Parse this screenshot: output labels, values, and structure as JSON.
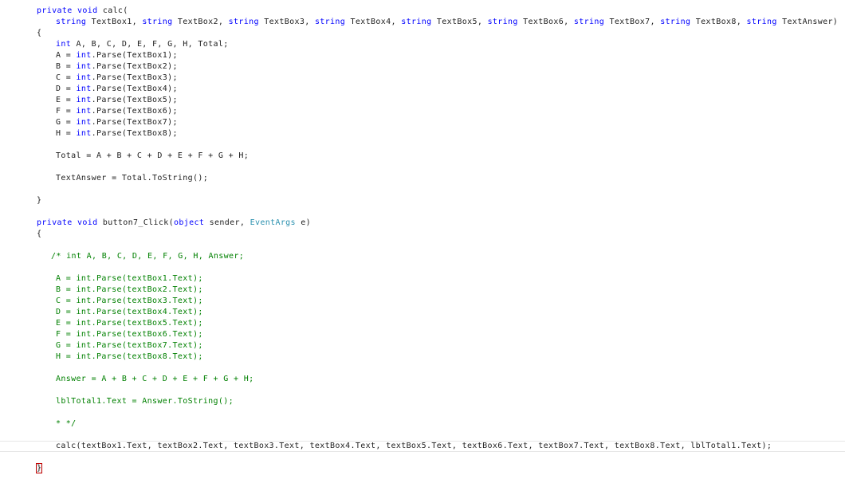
{
  "colors": {
    "keyword": "#0000ff",
    "type": "#2b91af",
    "comment": "#008000",
    "text": "#1e1e1e",
    "brace_highlight": "#c00000",
    "current_line_border": "#e6e6e6"
  },
  "code_lines": [
    {
      "indent": 46,
      "tokens": [
        {
          "t": "kw",
          "v": "private"
        },
        {
          "t": "plain",
          "v": " "
        },
        {
          "t": "kw",
          "v": "void"
        },
        {
          "t": "plain",
          "v": " calc("
        }
      ]
    },
    {
      "indent": 70,
      "tokens": [
        {
          "t": "kw",
          "v": "string"
        },
        {
          "t": "plain",
          "v": " TextBox1, "
        },
        {
          "t": "kw",
          "v": "string"
        },
        {
          "t": "plain",
          "v": " TextBox2, "
        },
        {
          "t": "kw",
          "v": "string"
        },
        {
          "t": "plain",
          "v": " TextBox3, "
        },
        {
          "t": "kw",
          "v": "string"
        },
        {
          "t": "plain",
          "v": " TextBox4, "
        },
        {
          "t": "kw",
          "v": "string"
        },
        {
          "t": "plain",
          "v": " TextBox5, "
        },
        {
          "t": "kw",
          "v": "string"
        },
        {
          "t": "plain",
          "v": " TextBox6, "
        },
        {
          "t": "kw",
          "v": "string"
        },
        {
          "t": "plain",
          "v": " TextBox7, "
        },
        {
          "t": "kw",
          "v": "string"
        },
        {
          "t": "plain",
          "v": " TextBox8, "
        },
        {
          "t": "kw",
          "v": "string"
        },
        {
          "t": "plain",
          "v": " TextAnswer)"
        }
      ]
    },
    {
      "indent": 46,
      "tokens": [
        {
          "t": "plain",
          "v": "{"
        }
      ]
    },
    {
      "indent": 70,
      "tokens": [
        {
          "t": "kw",
          "v": "int"
        },
        {
          "t": "plain",
          "v": " A, B, C, D, E, F, G, H, Total;"
        }
      ]
    },
    {
      "indent": 70,
      "tokens": [
        {
          "t": "plain",
          "v": "A = "
        },
        {
          "t": "kw",
          "v": "int"
        },
        {
          "t": "plain",
          "v": ".Parse(TextBox1);"
        }
      ]
    },
    {
      "indent": 70,
      "tokens": [
        {
          "t": "plain",
          "v": "B = "
        },
        {
          "t": "kw",
          "v": "int"
        },
        {
          "t": "plain",
          "v": ".Parse(TextBox2);"
        }
      ]
    },
    {
      "indent": 70,
      "tokens": [
        {
          "t": "plain",
          "v": "C = "
        },
        {
          "t": "kw",
          "v": "int"
        },
        {
          "t": "plain",
          "v": ".Parse(TextBox3);"
        }
      ]
    },
    {
      "indent": 70,
      "tokens": [
        {
          "t": "plain",
          "v": "D = "
        },
        {
          "t": "kw",
          "v": "int"
        },
        {
          "t": "plain",
          "v": ".Parse(TextBox4);"
        }
      ]
    },
    {
      "indent": 70,
      "tokens": [
        {
          "t": "plain",
          "v": "E = "
        },
        {
          "t": "kw",
          "v": "int"
        },
        {
          "t": "plain",
          "v": ".Parse(TextBox5);"
        }
      ]
    },
    {
      "indent": 70,
      "tokens": [
        {
          "t": "plain",
          "v": "F = "
        },
        {
          "t": "kw",
          "v": "int"
        },
        {
          "t": "plain",
          "v": ".Parse(TextBox6);"
        }
      ]
    },
    {
      "indent": 70,
      "tokens": [
        {
          "t": "plain",
          "v": "G = "
        },
        {
          "t": "kw",
          "v": "int"
        },
        {
          "t": "plain",
          "v": ".Parse(TextBox7);"
        }
      ]
    },
    {
      "indent": 70,
      "tokens": [
        {
          "t": "plain",
          "v": "H = "
        },
        {
          "t": "kw",
          "v": "int"
        },
        {
          "t": "plain",
          "v": ".Parse(TextBox8);"
        }
      ]
    },
    {
      "indent": 70,
      "tokens": []
    },
    {
      "indent": 70,
      "tokens": [
        {
          "t": "plain",
          "v": "Total = A + B + C + D + E + F + G + H;"
        }
      ]
    },
    {
      "indent": 70,
      "tokens": []
    },
    {
      "indent": 70,
      "tokens": [
        {
          "t": "plain",
          "v": "TextAnswer = Total.ToString();"
        }
      ]
    },
    {
      "indent": 70,
      "tokens": []
    },
    {
      "indent": 46,
      "tokens": [
        {
          "t": "plain",
          "v": "}"
        }
      ]
    },
    {
      "indent": 46,
      "tokens": []
    },
    {
      "indent": 46,
      "tokens": [
        {
          "t": "kw",
          "v": "private"
        },
        {
          "t": "plain",
          "v": " "
        },
        {
          "t": "kw",
          "v": "void"
        },
        {
          "t": "plain",
          "v": " button7_Click("
        },
        {
          "t": "kw",
          "v": "object"
        },
        {
          "t": "plain",
          "v": " sender, "
        },
        {
          "t": "type",
          "v": "EventArgs"
        },
        {
          "t": "plain",
          "v": " e)"
        }
      ]
    },
    {
      "indent": 46,
      "tokens": [
        {
          "t": "plain",
          "v": "{"
        }
      ]
    },
    {
      "indent": 46,
      "tokens": []
    },
    {
      "indent": 64,
      "tokens": [
        {
          "t": "comment",
          "v": "/* int A, B, C, D, E, F, G, H, Answer;"
        }
      ]
    },
    {
      "indent": 64,
      "tokens": []
    },
    {
      "indent": 70,
      "tokens": [
        {
          "t": "comment",
          "v": "A = int.Parse(textBox1.Text);"
        }
      ]
    },
    {
      "indent": 70,
      "tokens": [
        {
          "t": "comment",
          "v": "B = int.Parse(textBox2.Text);"
        }
      ]
    },
    {
      "indent": 70,
      "tokens": [
        {
          "t": "comment",
          "v": "C = int.Parse(textBox3.Text);"
        }
      ]
    },
    {
      "indent": 70,
      "tokens": [
        {
          "t": "comment",
          "v": "D = int.Parse(textBox4.Text);"
        }
      ]
    },
    {
      "indent": 70,
      "tokens": [
        {
          "t": "comment",
          "v": "E = int.Parse(textBox5.Text);"
        }
      ]
    },
    {
      "indent": 70,
      "tokens": [
        {
          "t": "comment",
          "v": "F = int.Parse(textBox6.Text);"
        }
      ]
    },
    {
      "indent": 70,
      "tokens": [
        {
          "t": "comment",
          "v": "G = int.Parse(textBox7.Text);"
        }
      ]
    },
    {
      "indent": 70,
      "tokens": [
        {
          "t": "comment",
          "v": "H = int.Parse(textBox8.Text);"
        }
      ]
    },
    {
      "indent": 70,
      "tokens": []
    },
    {
      "indent": 70,
      "tokens": [
        {
          "t": "comment",
          "v": "Answer = A + B + C + D + E + F + G + H;"
        }
      ]
    },
    {
      "indent": 70,
      "tokens": []
    },
    {
      "indent": 70,
      "tokens": [
        {
          "t": "comment",
          "v": "lblTotal1.Text = Answer.ToString();"
        }
      ]
    },
    {
      "indent": 70,
      "tokens": []
    },
    {
      "indent": 70,
      "tokens": [
        {
          "t": "comment",
          "v": "* */"
        }
      ]
    },
    {
      "indent": 70,
      "tokens": []
    },
    {
      "indent": 70,
      "current": true,
      "tokens": [
        {
          "t": "plain",
          "v": "calc(textBox1.Text, textBox2.Text, textBox3.Text, textBox4.Text, textBox5.Text, textBox6.Text, textBox7.Text, textBox8.Text, lblTotal1.Text);"
        }
      ]
    },
    {
      "indent": 70,
      "tokens": []
    },
    {
      "indent": 46,
      "brace": true,
      "tokens": [
        {
          "t": "plain",
          "v": "}"
        }
      ]
    }
  ]
}
